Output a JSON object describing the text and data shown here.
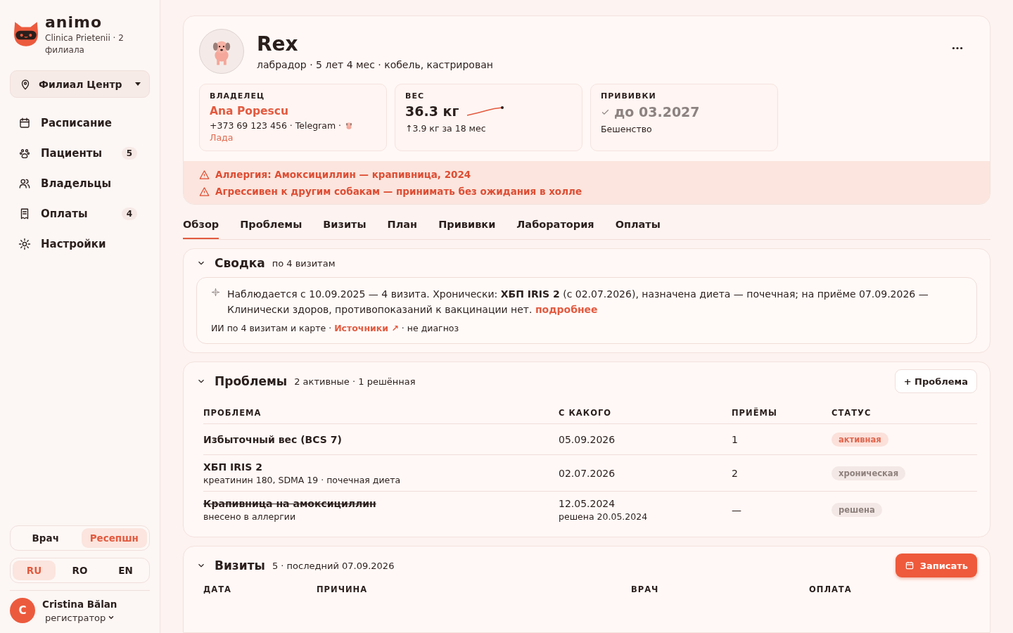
{
  "sidebar": {
    "brand": {
      "name": "animo",
      "subtitle": "Clinica Prietenii · 2 филиала"
    },
    "branch_select": {
      "value": "Филиал Центр"
    },
    "nav": [
      {
        "label": "Расписание"
      },
      {
        "label": "Пациенты",
        "badge": "5"
      },
      {
        "label": "Владельцы"
      },
      {
        "label": "Оплаты",
        "badge": "4"
      },
      {
        "label": "Настройки"
      }
    ],
    "role_switch": [
      {
        "label": "Врач",
        "selected": false
      },
      {
        "label": "Ресепшн",
        "selected": true
      }
    ],
    "languages": [
      {
        "label": "RU",
        "selected": true
      },
      {
        "label": "RO",
        "selected": false
      },
      {
        "label": "EN",
        "selected": false
      }
    ],
    "user": {
      "initial": "C",
      "name": "Cristina Bălan",
      "role": "регистратор"
    }
  },
  "patient": {
    "name": "Rex",
    "details": "лабрадор · 5 лет 4 мес · кобель, кастрирован",
    "owner": {
      "label": "ВЛАДЕЛЕЦ",
      "name": "Ana Popescu",
      "contact": "+373 69 123 456 · Telegram ·",
      "pet": "Лада"
    },
    "weight": {
      "label": "ВЕС",
      "value": "36.3 кг",
      "trend": "↑3.9 кг за 18 мес"
    },
    "vaccinations": {
      "label": "ПРИВИВКИ",
      "value": "до 03.2027",
      "note": "Бешенство"
    },
    "alerts": [
      "Аллергия: Амоксициллин — крапивница, 2024",
      "Агрессивен к другим собакам — принимать без ожидания в холле"
    ]
  },
  "tabs": [
    {
      "label": "Обзор",
      "selected": true
    },
    {
      "label": "Проблемы",
      "selected": false
    },
    {
      "label": "Визиты",
      "selected": false
    },
    {
      "label": "План",
      "selected": false
    },
    {
      "label": "Прививки",
      "selected": false
    },
    {
      "label": "Лаборатория",
      "selected": false
    },
    {
      "label": "Оплаты",
      "selected": false
    }
  ],
  "summary": {
    "title": "Сводка",
    "subtitle": "по 4 визитам",
    "text": "Наблюдается с 10.09.2025 — 4 визита. Хронически: **ХБП IRIS 2** (с 02.07.2026), назначена диета — почечная; на приёме 07.09.2026 — Клинически здоров, противопоказаний к вакцинации нет.",
    "more_link": "подробнее",
    "footer_before": "ИИ по 4 визитам и карте ·",
    "sources_link": "Источники ↗",
    "footer_after": "· не диагноз"
  },
  "problems": {
    "title": "Проблемы",
    "subtitle": "2 активные · 1 решённая",
    "add_button": "+ Проблема",
    "columns": [
      "ПРОБЛЕМА",
      "С КАКОГО",
      "ПРИЁМЫ",
      "СТАТУС"
    ],
    "rows": [
      {
        "name": "Избыточный вес (BCS 7)",
        "since": "05.09.2026",
        "visits": "1",
        "status": "активная",
        "kind": "active"
      },
      {
        "name": "ХБП IRIS 2",
        "note": "креатинин 180, SDMA 19 · почечная диета",
        "since": "02.07.2026",
        "visits": "2",
        "status": "хроническая",
        "kind": "chronic"
      },
      {
        "name": "Крапивница на амоксициллин",
        "note": "внесено в аллергии",
        "since": "12.05.2024",
        "since_note": "решена 20.05.2024",
        "visits": "—",
        "status": "решена",
        "kind": "resolved"
      }
    ]
  },
  "visits": {
    "title": "Визиты",
    "subtitle": "5 · последний 07.09.2026",
    "add_button": "Записать",
    "columns": [
      "ДАТА",
      "ПРИЧИНА",
      "ВРАЧ",
      "ОПЛАТА"
    ]
  }
}
